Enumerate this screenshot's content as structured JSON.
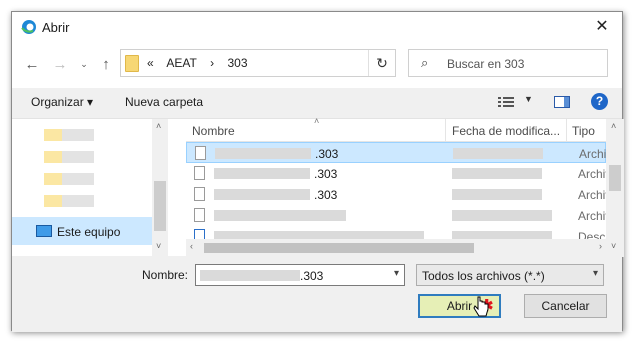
{
  "window": {
    "title": "Abrir",
    "close_icon": "close-icon"
  },
  "nav": {
    "back_icon": "back-arrow-icon",
    "forward_icon": "forward-arrow-icon",
    "recent_icon": "chevron-down-icon",
    "up_icon": "up-arrow-icon",
    "breadcrumb": [
      "«",
      "AEAT",
      "›",
      "303"
    ],
    "refresh_icon": "refresh-icon",
    "search_placeholder": "Buscar en 303"
  },
  "toolbar": {
    "organize_label": "Organizar ▾",
    "new_folder_label": "Nueva carpeta"
  },
  "sidebar": {
    "selected_item": "Este equipo"
  },
  "columns": {
    "name": "Nombre",
    "date": "Fecha de modifica...",
    "type": "Tipo"
  },
  "files": [
    {
      "name_suffix": ".303",
      "type": "Archivo",
      "selected": true
    },
    {
      "name_suffix": ".303",
      "type": "Archivo"
    },
    {
      "name_suffix": ".303",
      "type": "Archivo"
    },
    {
      "name_suffix": "",
      "type": "Archivo"
    },
    {
      "name_suffix": "",
      "type": "Descar"
    }
  ],
  "filename": {
    "label": "Nombre:",
    "value": ".303"
  },
  "filetype": {
    "value": "Todos los archivos (*.*)"
  },
  "buttons": {
    "open": "Abrir",
    "cancel": "Cancelar"
  },
  "colors": {
    "accent": "#2f7cbf",
    "selection": "#cce8ff",
    "highlight_button": "#e6efb6",
    "marker": "#e0141e"
  }
}
